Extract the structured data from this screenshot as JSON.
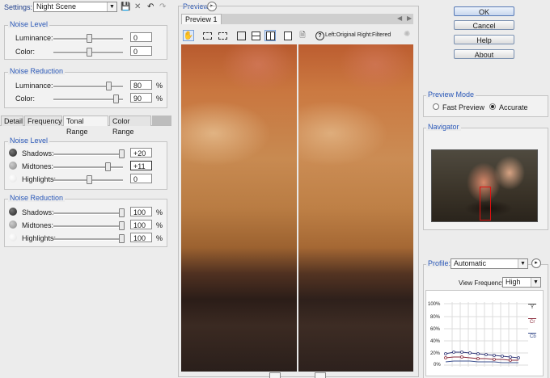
{
  "settings": {
    "label": "Settings:",
    "preset": "Night Scene"
  },
  "top_panel": {
    "noise_level_title": "Noise Level",
    "luminance_label": "Luminance:",
    "luminance_value": "0",
    "color_label": "Color:",
    "color_value": "0",
    "noise_reduction_title": "Noise Reduction",
    "nr_luminance_label": "Luminance:",
    "nr_luminance_value": "80",
    "nr_color_label": "Color:",
    "nr_color_value": "90",
    "percent": "%"
  },
  "tabs": [
    "Detail",
    "Frequency",
    "Tonal Range",
    "Color Range"
  ],
  "tonal": {
    "noise_level_title": "Noise Level",
    "shadows_label": "Shadows:",
    "shadows_value": "+20",
    "midtones_label": "Midtones:",
    "midtones_value": "+11",
    "highlights_label": "Highlights:",
    "highlights_value": "0",
    "noise_reduction_title": "Noise Reduction",
    "nr_shadows_label": "Shadows:",
    "nr_shadows_value": "100",
    "nr_midtones_label": "Midtones:",
    "nr_midtones_value": "100",
    "nr_highlights_label": "Highlights:",
    "nr_highlights_value": "100",
    "percent": "%"
  },
  "preview": {
    "section_title": "Preview",
    "tab_label": "Preview 1",
    "compare_label": "Left:Original Right:Filtered"
  },
  "buttons": {
    "ok": "OK",
    "cancel": "Cancel",
    "help": "Help",
    "about": "About"
  },
  "preview_mode": {
    "title": "Preview Mode",
    "fast": "Fast Preview",
    "accurate": "Accurate",
    "selected": "Accurate"
  },
  "navigator": {
    "title": "Navigator"
  },
  "profile": {
    "label": "Profile:",
    "value": "Automatic",
    "view_freq_label": "View Frequency:",
    "view_freq_value": "High",
    "y_ticks": [
      "100%",
      "80%",
      "60%",
      "40%",
      "20%",
      "0%"
    ],
    "legend": [
      "Y",
      "Cr",
      "Cb"
    ]
  }
}
